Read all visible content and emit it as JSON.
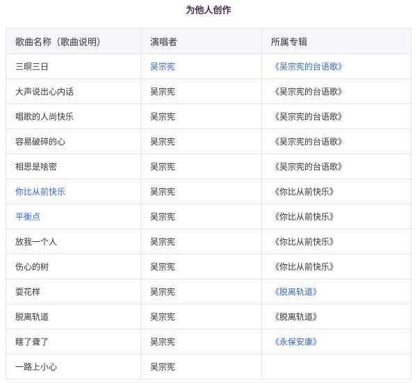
{
  "title": "为他人创作",
  "headers": [
    "歌曲名称（歌曲说明）",
    "演唱者",
    "所属专辑"
  ],
  "rows": [
    {
      "song": "三暝三日",
      "song_link": false,
      "singer": "吴宗宪",
      "singer_link": true,
      "album": "《吴宗宪的台语歌》",
      "album_link": true
    },
    {
      "song": "大声说出心内话",
      "song_link": false,
      "singer": "吴宗宪",
      "singer_link": false,
      "album": "《吴宗宪的台语歌》",
      "album_link": false
    },
    {
      "song": "唱歌的人尚快乐",
      "song_link": false,
      "singer": "吴宗宪",
      "singer_link": false,
      "album": "《吴宗宪的台语歌》",
      "album_link": false
    },
    {
      "song": "容易破碎的心",
      "song_link": false,
      "singer": "吴宗宪",
      "singer_link": false,
      "album": "《吴宗宪的台语歌》",
      "album_link": false
    },
    {
      "song": "相思是啥密",
      "song_link": false,
      "singer": "吴宗宪",
      "singer_link": false,
      "album": "《吴宗宪的台语歌》",
      "album_link": false
    },
    {
      "song": "你比从前快乐",
      "song_link": true,
      "singer": "吴宗宪",
      "singer_link": false,
      "album": "《你比从前快乐》",
      "album_link": false
    },
    {
      "song": "平衡点",
      "song_link": true,
      "singer": "吴宗宪",
      "singer_link": false,
      "album": "《你比从前快乐》",
      "album_link": false
    },
    {
      "song": "放我一个人",
      "song_link": false,
      "singer": "吴宗宪",
      "singer_link": false,
      "album": "《你比从前快乐》",
      "album_link": false
    },
    {
      "song": "伤心的树",
      "song_link": false,
      "singer": "吴宗宪",
      "singer_link": false,
      "album": "《你比从前快乐》",
      "album_link": false
    },
    {
      "song": "耍花样",
      "song_link": false,
      "singer": "吴宗宪",
      "singer_link": false,
      "album": "《脱离轨道》",
      "album_link": true
    },
    {
      "song": "脱离轨道",
      "song_link": false,
      "singer": "吴宗宪",
      "singer_link": false,
      "album": "《脱离轨道》",
      "album_link": false
    },
    {
      "song": "瞎了聋了",
      "song_link": false,
      "singer": "吴宗宪",
      "singer_link": false,
      "album": "《永保安康》",
      "album_link": true
    },
    {
      "song": "一路上小心",
      "song_link": false,
      "singer": "吴宗宪",
      "singer_link": false,
      "album": "",
      "album_link": false
    }
  ],
  "colors": {
    "link": "#3366cc",
    "text": "#333333",
    "title": "#4a2a52",
    "header_bg": "#f4f6fb",
    "border": "#e1e4ec"
  }
}
